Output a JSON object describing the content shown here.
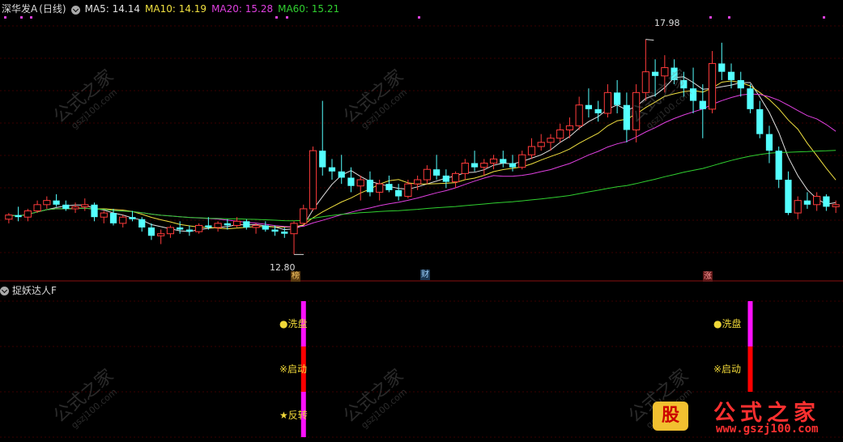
{
  "header": {
    "stock_name": "深华发A",
    "period": "(日线)",
    "ma5_label": "MA5: 14.14",
    "ma10_label": "MA10: 14.19",
    "ma20_label": "MA20: 15.28",
    "ma60_label": "MA60: 15.21",
    "ma5_color": "#e0e0e0",
    "ma10_color": "#f0e040",
    "ma20_color": "#e040e0",
    "ma60_color": "#30d030"
  },
  "price_chart": {
    "high_label": "17.98",
    "low_label": "12.80",
    "markers": [
      "榜",
      "财",
      "涨"
    ]
  },
  "indicator_panel": {
    "title": "捉妖达人F",
    "signal_1": {
      "wash": "●洗盘",
      "start": "※启动",
      "reverse": "★反转"
    },
    "signal_2": {
      "wash": "●洗盘",
      "start": "※启动"
    }
  },
  "watermark": {
    "cn": "公式之家",
    "url": "gszj100.com"
  },
  "logo": {
    "badge": "股",
    "title": "公式之家",
    "url": "www.gszj100.com"
  },
  "chart_data": {
    "type": "candlestick",
    "up_color": "#ff3b3b",
    "down_color": "#54ffff",
    "ylim": [
      12.3,
      18.5
    ],
    "x": [
      1,
      2,
      3,
      4,
      5,
      6,
      7,
      8,
      9,
      10,
      11,
      12,
      13,
      14,
      15,
      16,
      16,
      17,
      18,
      19,
      20,
      21,
      22,
      23,
      24,
      25,
      26,
      27,
      28,
      29,
      30,
      31,
      32,
      33,
      34,
      35,
      36,
      37,
      38,
      39,
      40,
      41,
      42,
      43,
      44,
      45,
      46,
      47,
      48,
      49,
      50,
      51,
      52,
      53,
      54,
      55,
      56,
      57,
      58,
      59,
      60,
      61,
      62,
      63,
      64,
      65,
      66,
      67,
      68,
      69,
      70,
      71,
      72,
      73,
      74,
      75,
      76,
      77,
      78,
      79,
      80,
      81,
      82,
      83,
      84,
      85,
      86,
      87
    ],
    "candles": [
      [
        13.65,
        13.8,
        13.55,
        13.75
      ],
      [
        13.75,
        13.95,
        13.6,
        13.7
      ],
      [
        13.7,
        13.9,
        13.6,
        13.85
      ],
      [
        13.85,
        14.1,
        13.8,
        14.0
      ],
      [
        14.0,
        14.2,
        13.9,
        14.1
      ],
      [
        14.1,
        14.25,
        13.95,
        14.0
      ],
      [
        14.0,
        14.1,
        13.85,
        13.9
      ],
      [
        13.9,
        14.05,
        13.8,
        13.95
      ],
      [
        13.95,
        14.15,
        13.85,
        14.0
      ],
      [
        14.0,
        14.05,
        13.6,
        13.7
      ],
      [
        13.7,
        13.85,
        13.55,
        13.8
      ],
      [
        13.8,
        13.9,
        13.5,
        13.55
      ],
      [
        13.55,
        13.75,
        13.45,
        13.7
      ],
      [
        13.7,
        13.85,
        13.6,
        13.65
      ],
      [
        13.65,
        13.7,
        13.35,
        13.45
      ],
      [
        13.45,
        13.55,
        13.15,
        13.25
      ],
      [
        13.25,
        13.4,
        13.05,
        13.3
      ],
      [
        13.3,
        13.5,
        13.2,
        13.45
      ],
      [
        13.45,
        13.6,
        13.3,
        13.4
      ],
      [
        13.4,
        13.5,
        13.25,
        13.35
      ],
      [
        13.35,
        13.55,
        13.3,
        13.5
      ],
      [
        13.5,
        13.7,
        13.4,
        13.45
      ],
      [
        13.45,
        13.6,
        13.35,
        13.55
      ],
      [
        13.55,
        13.65,
        13.4,
        13.5
      ],
      [
        13.5,
        13.7,
        13.45,
        13.6
      ],
      [
        13.6,
        13.65,
        13.4,
        13.45
      ],
      [
        13.45,
        13.55,
        13.3,
        13.5
      ],
      [
        13.5,
        13.6,
        13.35,
        13.4
      ],
      [
        13.4,
        13.5,
        13.25,
        13.35
      ],
      [
        13.35,
        13.45,
        13.2,
        13.3
      ],
      [
        13.3,
        13.6,
        12.8,
        13.55
      ],
      [
        13.55,
        14.0,
        13.5,
        13.9
      ],
      [
        13.9,
        15.4,
        13.85,
        15.3
      ],
      [
        15.3,
        16.5,
        14.7,
        14.9
      ],
      [
        14.9,
        15.1,
        14.6,
        14.8
      ],
      [
        14.8,
        15.2,
        14.5,
        14.65
      ],
      [
        14.65,
        14.9,
        14.3,
        14.45
      ],
      [
        14.45,
        14.7,
        14.1,
        14.6
      ],
      [
        14.6,
        14.8,
        14.2,
        14.3
      ],
      [
        14.3,
        14.6,
        14.1,
        14.5
      ],
      [
        14.5,
        14.7,
        14.3,
        14.35
      ],
      [
        14.35,
        14.5,
        14.1,
        14.2
      ],
      [
        14.2,
        14.6,
        14.15,
        14.5
      ],
      [
        14.5,
        14.7,
        14.35,
        14.6
      ],
      [
        14.6,
        14.95,
        14.5,
        14.85
      ],
      [
        14.85,
        15.2,
        14.6,
        14.7
      ],
      [
        14.7,
        14.85,
        14.4,
        14.55
      ],
      [
        14.55,
        14.8,
        14.4,
        14.75
      ],
      [
        14.75,
        15.1,
        14.6,
        15.0
      ],
      [
        15.0,
        15.3,
        14.8,
        14.9
      ],
      [
        14.9,
        15.1,
        14.7,
        15.0
      ],
      [
        15.0,
        15.2,
        14.85,
        15.1
      ],
      [
        15.1,
        15.3,
        14.9,
        15.0
      ],
      [
        15.0,
        15.2,
        14.8,
        14.9
      ],
      [
        14.9,
        15.3,
        14.85,
        15.2
      ],
      [
        15.2,
        15.6,
        15.1,
        15.4
      ],
      [
        15.4,
        15.7,
        15.3,
        15.5
      ],
      [
        15.5,
        15.7,
        15.3,
        15.6
      ],
      [
        15.6,
        15.95,
        15.5,
        15.8
      ],
      [
        15.8,
        16.1,
        15.6,
        15.9
      ],
      [
        15.9,
        16.6,
        15.8,
        16.4
      ],
      [
        16.4,
        16.8,
        16.1,
        16.3
      ],
      [
        16.3,
        16.5,
        16.0,
        16.2
      ],
      [
        16.2,
        16.9,
        16.1,
        16.7
      ],
      [
        16.7,
        17.0,
        16.2,
        16.4
      ],
      [
        16.4,
        16.7,
        15.5,
        15.8
      ],
      [
        15.8,
        16.9,
        15.5,
        16.7
      ],
      [
        16.7,
        17.98,
        16.5,
        17.2
      ],
      [
        17.2,
        17.5,
        16.6,
        17.1
      ],
      [
        17.1,
        17.6,
        16.7,
        17.3
      ],
      [
        17.3,
        17.5,
        16.9,
        17.0
      ],
      [
        17.0,
        17.2,
        16.6,
        16.8
      ],
      [
        16.8,
        17.3,
        16.2,
        16.5
      ],
      [
        16.5,
        16.9,
        15.6,
        16.3
      ],
      [
        16.3,
        17.7,
        16.2,
        17.4
      ],
      [
        17.4,
        17.9,
        17.0,
        17.2
      ],
      [
        17.2,
        17.4,
        16.8,
        17.0
      ],
      [
        17.0,
        17.2,
        16.6,
        16.8
      ],
      [
        16.8,
        16.9,
        16.2,
        16.3
      ],
      [
        16.3,
        16.5,
        15.6,
        15.7
      ],
      [
        15.7,
        15.9,
        15.0,
        15.3
      ],
      [
        15.3,
        15.4,
        14.4,
        14.6
      ],
      [
        14.6,
        14.8,
        13.75,
        13.8
      ],
      [
        13.8,
        14.2,
        13.65,
        14.1
      ],
      [
        14.1,
        14.3,
        13.9,
        14.0
      ],
      [
        14.0,
        14.3,
        13.85,
        14.2
      ],
      [
        14.2,
        14.25,
        13.85,
        13.95
      ],
      [
        13.95,
        14.1,
        13.8,
        14.0
      ]
    ],
    "signals": [
      {
        "x": 32,
        "labels": [
          "●洗盘",
          "※启动",
          "★反转"
        ]
      },
      {
        "x": 79,
        "labels": [
          "●洗盘",
          "※启动"
        ]
      }
    ]
  }
}
